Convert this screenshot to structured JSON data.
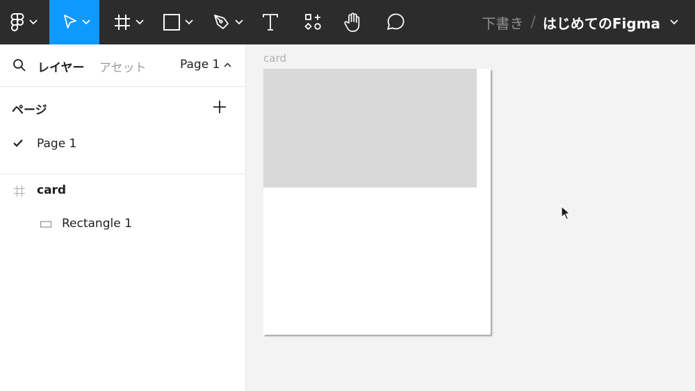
{
  "toolbar": {
    "tools": [
      {
        "name": "main-menu",
        "icon": "figma-logo-icon"
      },
      {
        "name": "move",
        "icon": "move-arrow-icon",
        "active": true
      },
      {
        "name": "frame",
        "icon": "frame-hash-icon"
      },
      {
        "name": "shape",
        "icon": "rectangle-icon"
      },
      {
        "name": "pen",
        "icon": "pen-icon"
      },
      {
        "name": "text",
        "icon": "text-icon"
      },
      {
        "name": "resources",
        "icon": "resources-icon"
      },
      {
        "name": "hand",
        "icon": "hand-icon"
      },
      {
        "name": "comment",
        "icon": "comment-icon"
      }
    ],
    "colors": {
      "background": "#2c2c2c",
      "active": "#0d99ff"
    }
  },
  "breadcrumb": {
    "draft": "下書き",
    "separator": "/",
    "file_name": "はじめてのFigma"
  },
  "left_panel": {
    "tabs": {
      "layers": "レイヤー",
      "assets": "アセット"
    },
    "current_page": "Page 1",
    "pages_title": "ページ",
    "pages": [
      {
        "label": "Page 1",
        "selected": true
      }
    ],
    "layers": [
      {
        "label": "card",
        "type": "frame"
      },
      {
        "label": "Rectangle 1",
        "type": "rectangle"
      }
    ]
  },
  "canvas": {
    "frame_name": "card",
    "colors": {
      "background": "#f3f3f3",
      "frame": "#ffffff",
      "rectangle": "#d9d9d9"
    }
  }
}
